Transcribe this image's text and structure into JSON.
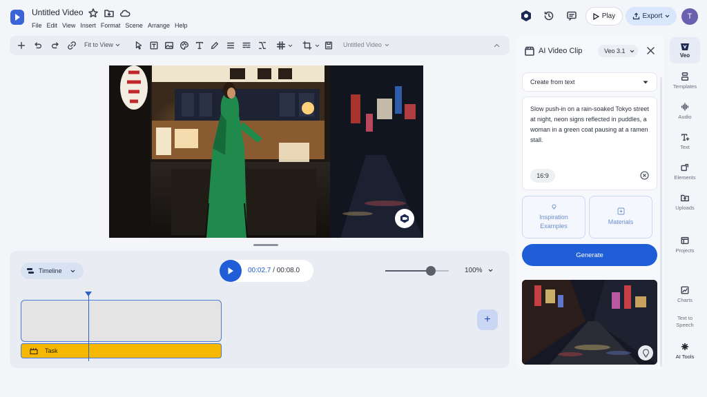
{
  "header": {
    "title": "Untitled Video",
    "menu": [
      "File",
      "Edit",
      "View",
      "Insert",
      "Format",
      "Scene",
      "Arrange",
      "Help"
    ],
    "play_label": "Play",
    "export_label": "Export",
    "avatar_initial": "T"
  },
  "toolbar": {
    "fit_label": "Fit to View",
    "video_title": "Untitled Video"
  },
  "timeline": {
    "dropdown_label": "Timeline",
    "current_time": "00:02.7",
    "separator": " / ",
    "total_time": "00:08.0",
    "zoom_percent": "100%",
    "zoom_level": 0.72,
    "playhead_progress": 0.3375,
    "task_label": "Task"
  },
  "ai_panel": {
    "title": "AI Video Clip",
    "model": "Veo 3.1",
    "mode": "Create from text",
    "prompt": "Slow push-in on a rain-soaked Tokyo street at night, neon signs reflected in puddles, a woman in a green coat pausing at a ramen stall.",
    "ratio": "16:9",
    "card_inspiration": "Inspiration Examples",
    "card_materials": "Materials",
    "generate_label": "Generate"
  },
  "rail": {
    "items": [
      {
        "label": "Veo"
      },
      {
        "label": "Templates"
      },
      {
        "label": "Audio"
      },
      {
        "label": "Text"
      },
      {
        "label": "Elements"
      },
      {
        "label": "Uploads"
      },
      {
        "label": "Projects"
      },
      {
        "label": "Charts"
      },
      {
        "label": "Text to Speech"
      },
      {
        "label": "AI Tools"
      }
    ]
  },
  "colors": {
    "accent": "#1f5ed6",
    "task": "#f5b700",
    "coat": "#1f8a4c"
  }
}
